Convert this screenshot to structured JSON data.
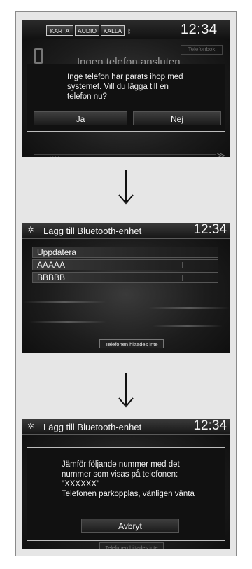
{
  "screen1": {
    "nav_tabs": [
      "KARTA",
      "AUDIO",
      "KALLA"
    ],
    "clock": "12:34",
    "background_title": "Ingen telefon ansluten",
    "background_tab": "Telefonbok",
    "background_row": "****",
    "dialog_text": "Inge telefon har parats ihop med\nsystemet. Vill du lägga till en\ntelefon nu?",
    "yes_label": "Ja",
    "no_label": "Nej"
  },
  "screen2": {
    "title": "Lägg till Bluetooth-enhet",
    "clock": "12:34",
    "items": [
      "Uppdatera",
      "AAAAA",
      "BBBBB"
    ],
    "status": "Telefonen hittades inte"
  },
  "screen3": {
    "title": "Lägg till Bluetooth-enhet",
    "clock": "12:34",
    "dialog_text": "Jämför följande nummer med det\nnummer som visas på telefonen:\n\"XXXXXX\"\nTelefonen parkopplas, vänligen vänta",
    "cancel_label": "Avbryt",
    "status": "Telefonen hittades inte"
  },
  "icons": {
    "arrow": "down-arrow-icon",
    "gear": "gear-icon",
    "phone": "phone-icon",
    "bluetooth": "bluetooth-icon",
    "chevron": "chevron-down-icon"
  }
}
